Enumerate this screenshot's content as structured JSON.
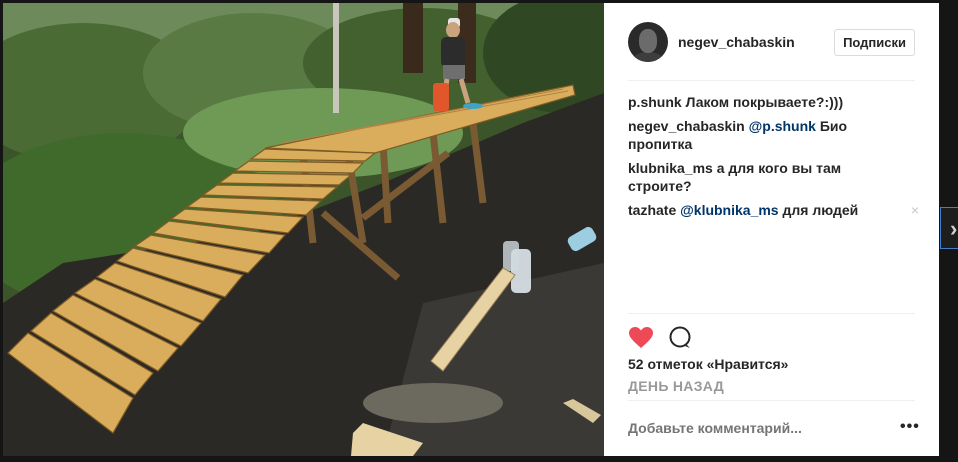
{
  "post": {
    "username": "negev_chabaskin",
    "follow_label": "Подписки",
    "comments": [
      {
        "author": "p.shunk",
        "mention": "",
        "text": "Лаком покрываете?:)))"
      },
      {
        "author": "negev_chabaskin",
        "mention": "@p.shunk",
        "text": "Био пропитка"
      },
      {
        "author": "klubnika_ms",
        "mention": "",
        "text": "а для кого вы там строите?"
      },
      {
        "author": "tazhate",
        "mention": "@klubnika_ms",
        "text": "для людей",
        "remove": "×"
      }
    ],
    "likes_text": "52 отметок «Нравится»",
    "time_ago": "ДЕНЬ НАЗАД",
    "add_comment_placeholder": "Добавьте комментарий...",
    "more_label": "•••",
    "next_label": "›"
  },
  "colors": {
    "like_heart": "#ed4956",
    "mention": "#003569",
    "muted": "#999999",
    "border": "#dbdbdb"
  },
  "icons": {
    "like": "heart-icon",
    "comment": "comment-bubble-icon",
    "more": "more-options-icon",
    "next": "chevron-right-icon"
  }
}
